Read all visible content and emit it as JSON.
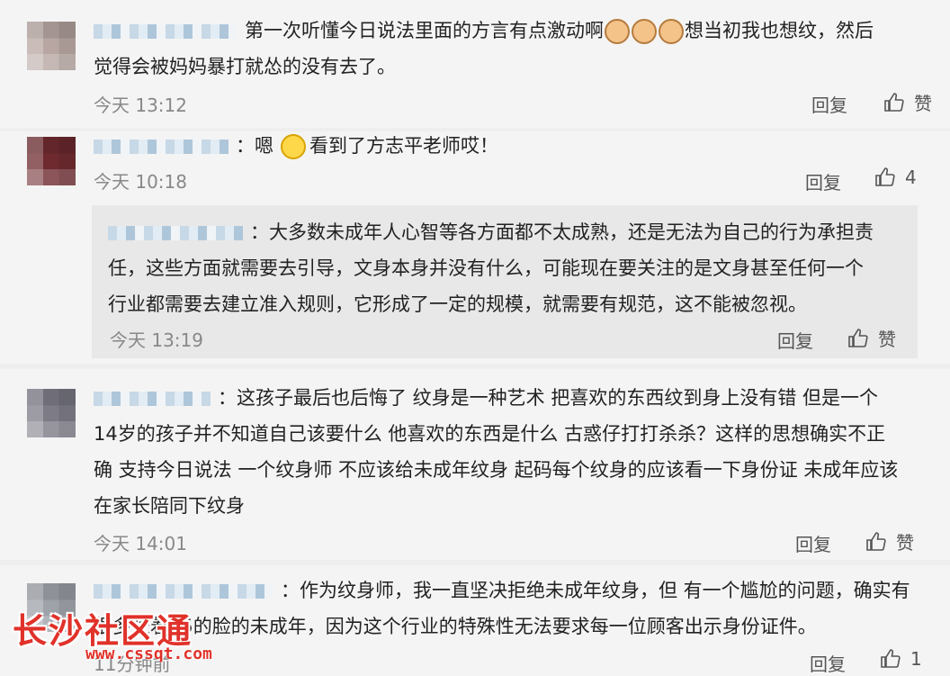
{
  "comments": [
    {
      "text_line1": "第一次听懂今日说法里面的方言有点激动啊",
      "text_line1b": "想当初我也想纹，然后",
      "text_line2": "觉得会被妈妈暴打就怂的没有去了。",
      "time": "今天 13:12",
      "reply_label": "回复",
      "like_label": "赞"
    },
    {
      "text_a": "：嗯",
      "text_b": "看到了方志平老师哎！",
      "time": "今天 10:18",
      "reply_label": "回复",
      "like_count": "4",
      "quote": {
        "line1": "：大多数未成年人心智等各方面都不太成熟，还是无法为自己的行为承担责",
        "line2": "任，这些方面就需要去引导，文身本身并没有什么，可能现在要关注的是文身甚至任何一个",
        "line3": "行业都需要去建立准入规则，它形成了一定的规模，就需要有规范，这不能被忽视。",
        "time": "今天 13:19",
        "reply_label": "回复",
        "like_label": "赞"
      }
    },
    {
      "line1": "：这孩子最后也后悔了  纹身是一种艺术  把喜欢的东西纹到身上没有错  但是一个",
      "line2": "14岁的孩子并不知道自己该要什么  他喜欢的东西是什么  古惑仔打打杀杀？这样的思想确实不正",
      "line3": "确  支持今日说法  一个纹身师  不应该给未成年纹身  起码每个纹身的应该看一下身份证  未成年应该",
      "line4": "在家长陪同下纹身",
      "time": "今天 14:01",
      "reply_label": "回复",
      "like_label": "赞"
    },
    {
      "line1": "：作为纹身师，我一直坚决拒绝未成年纹身，但  有一个尴尬的问题，确实有",
      "line2": "很多长着25的脸的未成年，因为这个行业的特殊性无法要求每一位顾客出示身份证件。",
      "time": "11分钟前",
      "reply_label": "回复",
      "like_count": "1"
    }
  ],
  "watermark": {
    "name": "长沙社区通",
    "url": "www.cssqt.com"
  },
  "colors": {
    "card_bg": "#f4f4f4",
    "quote_bg": "#e8e8e8",
    "watermark": "#e0322a"
  }
}
